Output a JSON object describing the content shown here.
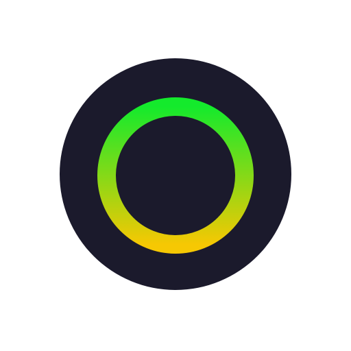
{
  "icon": {
    "name": "ring-logo-icon",
    "colors": {
      "page_background": "#ffffff",
      "badge_background": "#1b1a2c",
      "ring_gradient_top": "#14ea2c",
      "ring_gradient_bottom": "#f6c803"
    }
  }
}
